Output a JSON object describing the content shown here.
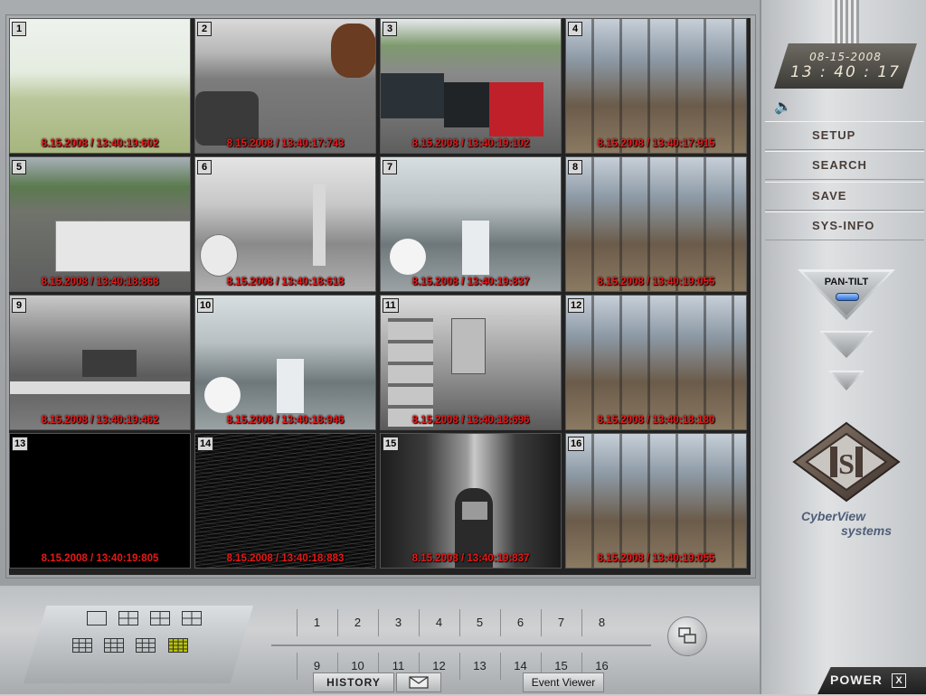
{
  "clock": {
    "date": "08-15-2008",
    "time": "13 : 40 : 17"
  },
  "menu": [
    {
      "label": "SETUP",
      "name": "setup-button"
    },
    {
      "label": "SEARCH",
      "name": "search-button"
    },
    {
      "label": "SAVE",
      "name": "save-button"
    },
    {
      "label": "SYS-INFO",
      "name": "sys-info-button"
    }
  ],
  "pantilt": {
    "label": "PAN-TILT"
  },
  "brand": {
    "line1": "CyberView",
    "line2": "systems"
  },
  "power": {
    "label": "POWER",
    "close": "X"
  },
  "cameras": [
    {
      "num": "1",
      "ts": "8.15.2008 / 13:40:19:602",
      "scene": "sky-lawn"
    },
    {
      "num": "2",
      "ts": "8.15.2008 / 13:40:17:743",
      "scene": "parking"
    },
    {
      "num": "3",
      "ts": "8.15.2008 / 13:40:19:102",
      "scene": "parking2"
    },
    {
      "num": "4",
      "ts": "8.15.2008 / 13:40:17:915",
      "scene": "warehouse"
    },
    {
      "num": "5",
      "ts": "8.15.2008 / 13:40:18:868",
      "scene": "loading"
    },
    {
      "num": "6",
      "ts": "8.15.2008 / 13:40:18:618",
      "scene": "mono-plant"
    },
    {
      "num": "7",
      "ts": "8.15.2008 / 13:40:19:837",
      "scene": "pressroom"
    },
    {
      "num": "8",
      "ts": "8.15.2008 / 13:40:19:055",
      "scene": "warehouse"
    },
    {
      "num": "9",
      "ts": "8.15.2008 / 13:40:19:462",
      "scene": "office"
    },
    {
      "num": "10",
      "ts": "8.15.2008 / 13:40:18:946",
      "scene": "pressroom"
    },
    {
      "num": "11",
      "ts": "8.15.2008 / 13:40:18:696",
      "scene": "storage"
    },
    {
      "num": "12",
      "ts": "8.15.2008 / 13:40:18:180",
      "scene": "warehouse"
    },
    {
      "num": "13",
      "ts": "8.15.2008 / 13:40:19:805",
      "scene": "black"
    },
    {
      "num": "14",
      "ts": "8.15.2008 / 13:40:18:883",
      "scene": "noise"
    },
    {
      "num": "15",
      "ts": "8.15.2008 / 13:40:19:837",
      "scene": "hallway"
    },
    {
      "num": "16",
      "ts": "8.15.2008 / 13:40:19:055",
      "scene": "warehouse"
    }
  ],
  "layouts": [
    {
      "name": "layout-1x1-button",
      "grid": 1
    },
    {
      "name": "layout-2x2-button",
      "grid": 2
    },
    {
      "name": "layout-2x2b-button",
      "grid": 2
    },
    {
      "name": "layout-2x2c-button",
      "grid": 2
    },
    {
      "name": "layout-3x3-button",
      "grid": 3
    },
    {
      "name": "layout-3x3b-button",
      "grid": 3
    },
    {
      "name": "layout-3x3c-button",
      "grid": 3
    },
    {
      "name": "layout-4x4-button",
      "grid": 4,
      "active": true
    }
  ],
  "channels_row1": [
    "1",
    "2",
    "3",
    "4",
    "5",
    "6",
    "7",
    "8"
  ],
  "channels_row2": [
    "9",
    "10",
    "11",
    "12",
    "13",
    "14",
    "15",
    "16"
  ],
  "buttons": {
    "history": "HISTORY",
    "event_viewer": "Event Viewer"
  },
  "colors": {
    "timestamp": "#e81818",
    "menu_text": "#4a3d36",
    "brand": "#4f5e7a",
    "active_layout": "#b9c400"
  }
}
